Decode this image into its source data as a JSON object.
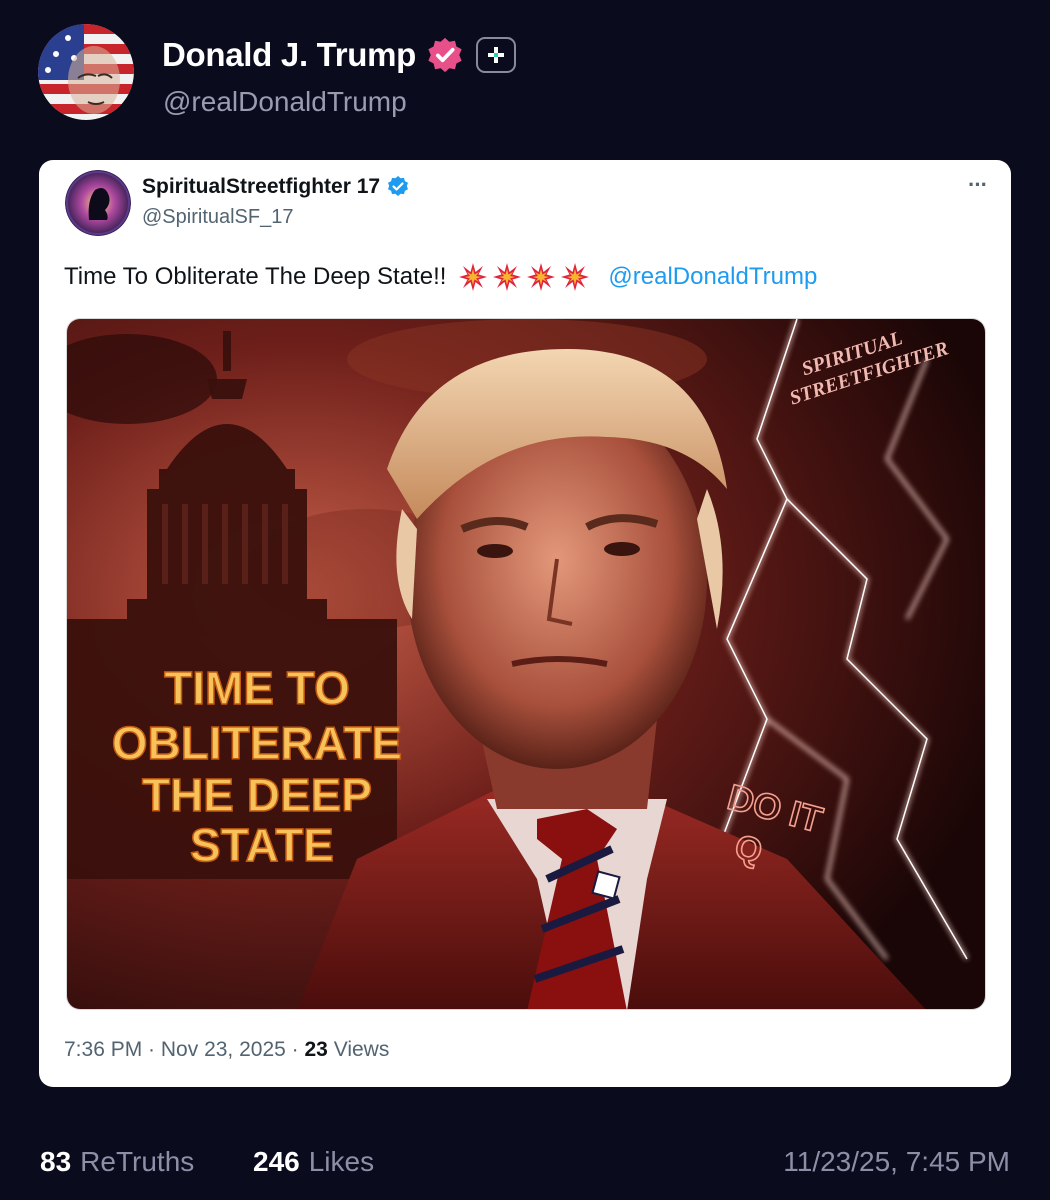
{
  "post": {
    "author_name": "Donald J. Trump",
    "author_handle": "@realDonaldTrump",
    "avatar_icon": "flag-portrait-avatar",
    "verified_icon": "verified-badge-icon",
    "follow_icon": "plus-icon"
  },
  "quoted": {
    "author_name": "SpiritualStreetfighter 17",
    "author_handle": "@SpiritualSF_17",
    "more_icon": "more-options-icon",
    "more_label": "···",
    "text": "Time To Obliterate The Deep State!!",
    "emoji": [
      "💥",
      "💥",
      "💥",
      "💥"
    ],
    "mention": "@realDonaldTrump",
    "image": {
      "headline_lines": [
        "TIME TO",
        "OBLITERATE",
        "THE DEEP",
        "STATE"
      ],
      "watermark_lines": [
        "SPIRITUAL",
        "STREETFIGHTER"
      ],
      "lapel_text_lines": [
        "DO IT",
        "Q"
      ]
    },
    "time": "7:36 PM",
    "separator": " · ",
    "date": "Nov 23, 2025",
    "views_count": "23",
    "views_label": "Views"
  },
  "stats": {
    "retruths_count": "83",
    "retruths_label": "ReTruths",
    "likes_count": "246",
    "likes_label": "Likes",
    "timestamp": "11/23/25, 7:45 PM"
  },
  "colors": {
    "page_bg": "#0b0b1e",
    "brand_pink": "#e8508a",
    "link_blue": "#1d9bf0",
    "muted_text": "#8e8ea6"
  }
}
